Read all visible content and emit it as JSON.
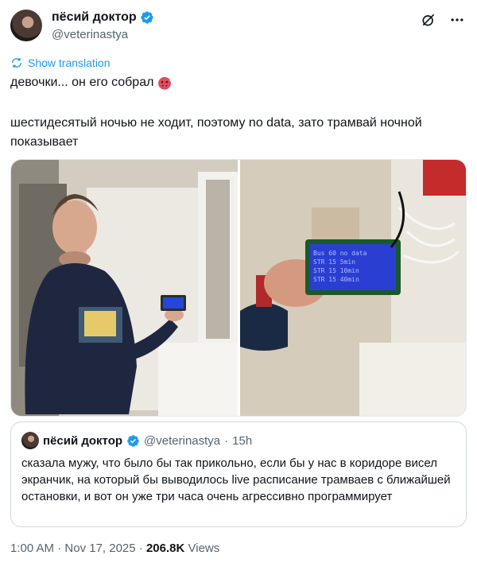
{
  "author": {
    "name": "пёсий доктор",
    "handle": "@veterinastya"
  },
  "translation": {
    "label": "Show translation"
  },
  "tweet": {
    "line1": "девочки... он его собрал",
    "line1_emoji": "hot-face-emoji",
    "body": "шестидесятый ночью не ходит, поэтому no data, зато трамвай ночной показывает"
  },
  "media": {
    "lcd_lines": [
      "Bus 60  no data",
      "STR 15  5min",
      "STR 15  10min",
      "STR 15  40min"
    ]
  },
  "quote": {
    "name": "пёсий доктор",
    "handle": "@veterinastya",
    "sep": "·",
    "time": "15h",
    "text": "сказала мужу, что было бы так прикольно, если бы у нас в коридоре висел экранчик, на который бы выводилось live расписание трамваев с ближайшей остановки, и вот он уже три часа очень агрессивно программирует"
  },
  "meta": {
    "time": "1:00 AM",
    "sep1": "·",
    "date": "Nov 17, 2025",
    "sep2": "·",
    "views_count": "206.8K",
    "views_label": "Views"
  },
  "colors": {
    "accent": "#1d9bf0",
    "muted": "#536471",
    "text": "#0f1419"
  }
}
